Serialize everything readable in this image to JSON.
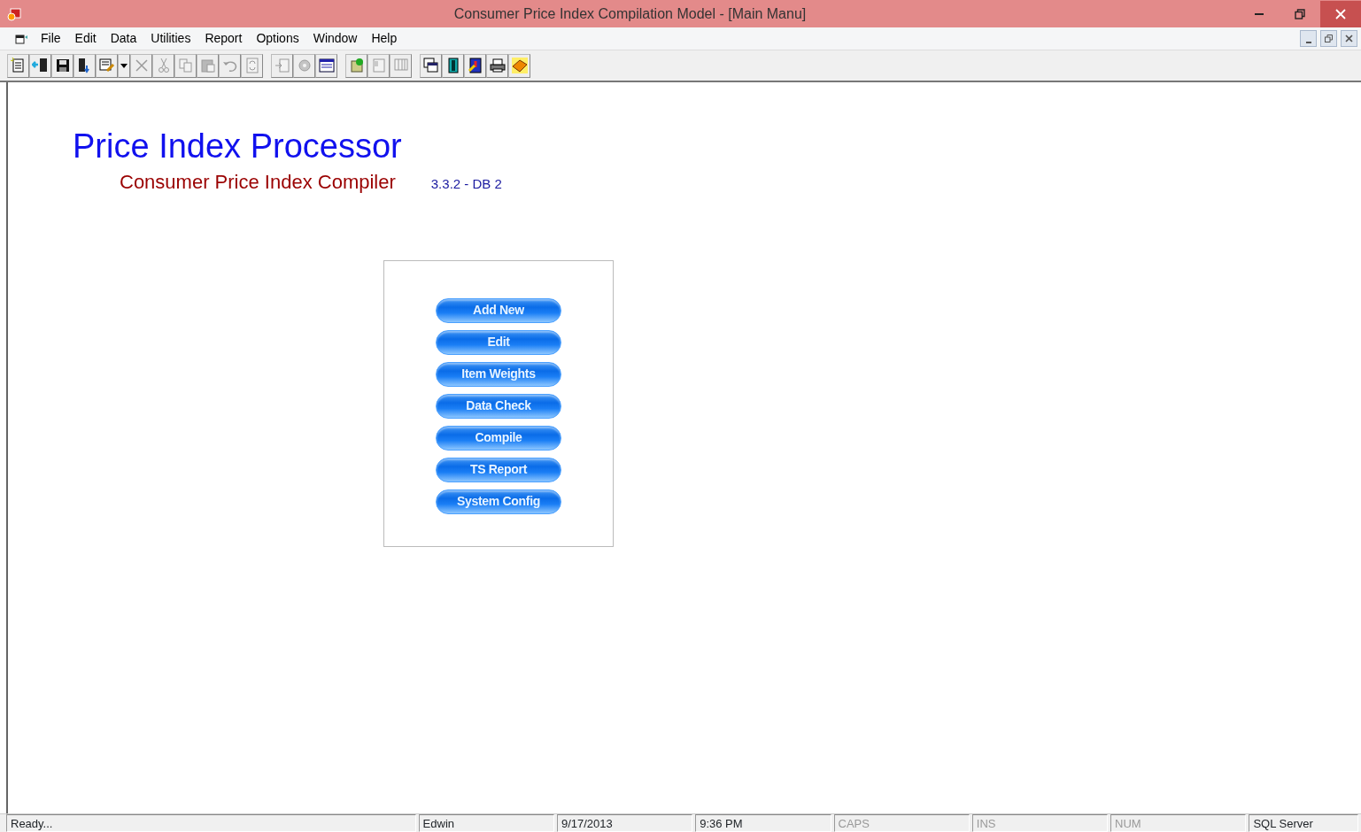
{
  "window": {
    "title": "Consumer Price Index Compilation Model - [Main Manu]"
  },
  "menu": [
    {
      "label": "File"
    },
    {
      "label": "Edit"
    },
    {
      "label": "Data"
    },
    {
      "label": "Utilities"
    },
    {
      "label": "Report"
    },
    {
      "label": "Options"
    },
    {
      "label": "Window"
    },
    {
      "label": "Help"
    }
  ],
  "toolbar": [
    [
      {
        "kind": "new",
        "disabled": false
      },
      {
        "kind": "exit",
        "disabled": false
      },
      {
        "kind": "save",
        "disabled": false
      },
      {
        "kind": "import",
        "disabled": false
      },
      {
        "kind": "edit",
        "disabled": false
      },
      {
        "kind": "dropdown",
        "disabled": false
      },
      {
        "kind": "delete",
        "disabled": true
      },
      {
        "kind": "cut",
        "disabled": true
      },
      {
        "kind": "copy",
        "disabled": true
      },
      {
        "kind": "paste",
        "disabled": true
      },
      {
        "kind": "undo",
        "disabled": true
      },
      {
        "kind": "refresh",
        "disabled": true
      }
    ],
    [
      {
        "kind": "insert",
        "disabled": true
      },
      {
        "kind": "gear",
        "disabled": true
      },
      {
        "kind": "calendar",
        "disabled": false
      }
    ],
    [
      {
        "kind": "database",
        "disabled": false
      },
      {
        "kind": "sheet",
        "disabled": true
      },
      {
        "kind": "columns",
        "disabled": true
      }
    ],
    [
      {
        "kind": "windows",
        "disabled": false
      },
      {
        "kind": "tube",
        "disabled": false
      },
      {
        "kind": "alert",
        "disabled": false
      },
      {
        "kind": "printer",
        "disabled": false
      },
      {
        "kind": "book",
        "disabled": false
      }
    ]
  ],
  "heading": {
    "title": "Price Index Processor",
    "subtitle": "Consumer Price Index Compiler",
    "version": "3.3.2 - DB 2"
  },
  "actions": [
    "Add New",
    "Edit",
    "Item Weights",
    "Data Check",
    "Compile",
    "TS Report",
    "System Config"
  ],
  "status_bar": [
    {
      "text": "Ready...",
      "enabled": true
    },
    {
      "text": "Edwin",
      "enabled": true
    },
    {
      "text": "9/17/2013",
      "enabled": true
    },
    {
      "text": "9:36 PM",
      "enabled": true
    },
    {
      "text": "CAPS",
      "enabled": false
    },
    {
      "text": "INS",
      "enabled": false
    },
    {
      "text": "NUM",
      "enabled": false
    },
    {
      "text": "SQL Server",
      "enabled": true
    }
  ]
}
